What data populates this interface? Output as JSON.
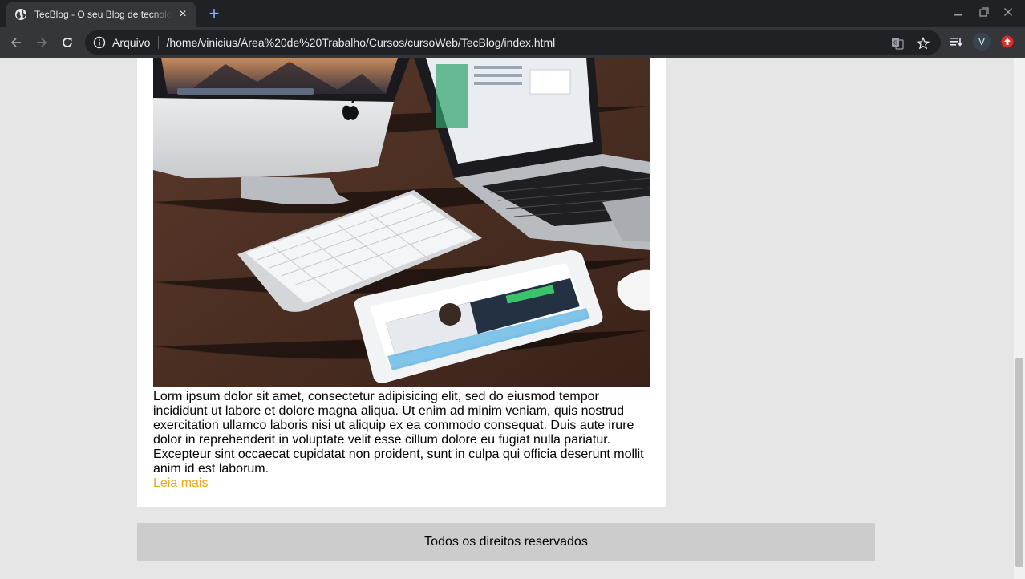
{
  "browser": {
    "tab_title": "TecBlog - O seu Blog de tecnologia",
    "new_tab": "+",
    "tab_close": "×",
    "scheme_label": "Arquivo",
    "url": "/home/vinicius/Área%20de%20Trabalho/Cursos/cursoWeb/TecBlog/index.html",
    "profile_initial": "V",
    "accent_color": "#8ab4f8"
  },
  "post": {
    "body": "Lorm ipsum dolor sit amet, consectetur adipisicing elit, sed do eiusmod tempor incididunt ut labore et dolore magna aliqua. Ut enim ad minim veniam, quis nostrud exercitation ullamco laboris nisi ut aliquip ex ea commodo consequat. Duis aute irure dolor in reprehenderit in voluptate velit esse cillum dolore eu fugiat nulla pariatur. Excepteur sint occaecat cupidatat non proident, sunt in culpa qui officia deserunt mollit anim id est laborum.",
    "read_more": "Leia mais",
    "link_color": "#e8a818"
  },
  "footer": {
    "text": "Todos os direitos reservados"
  }
}
